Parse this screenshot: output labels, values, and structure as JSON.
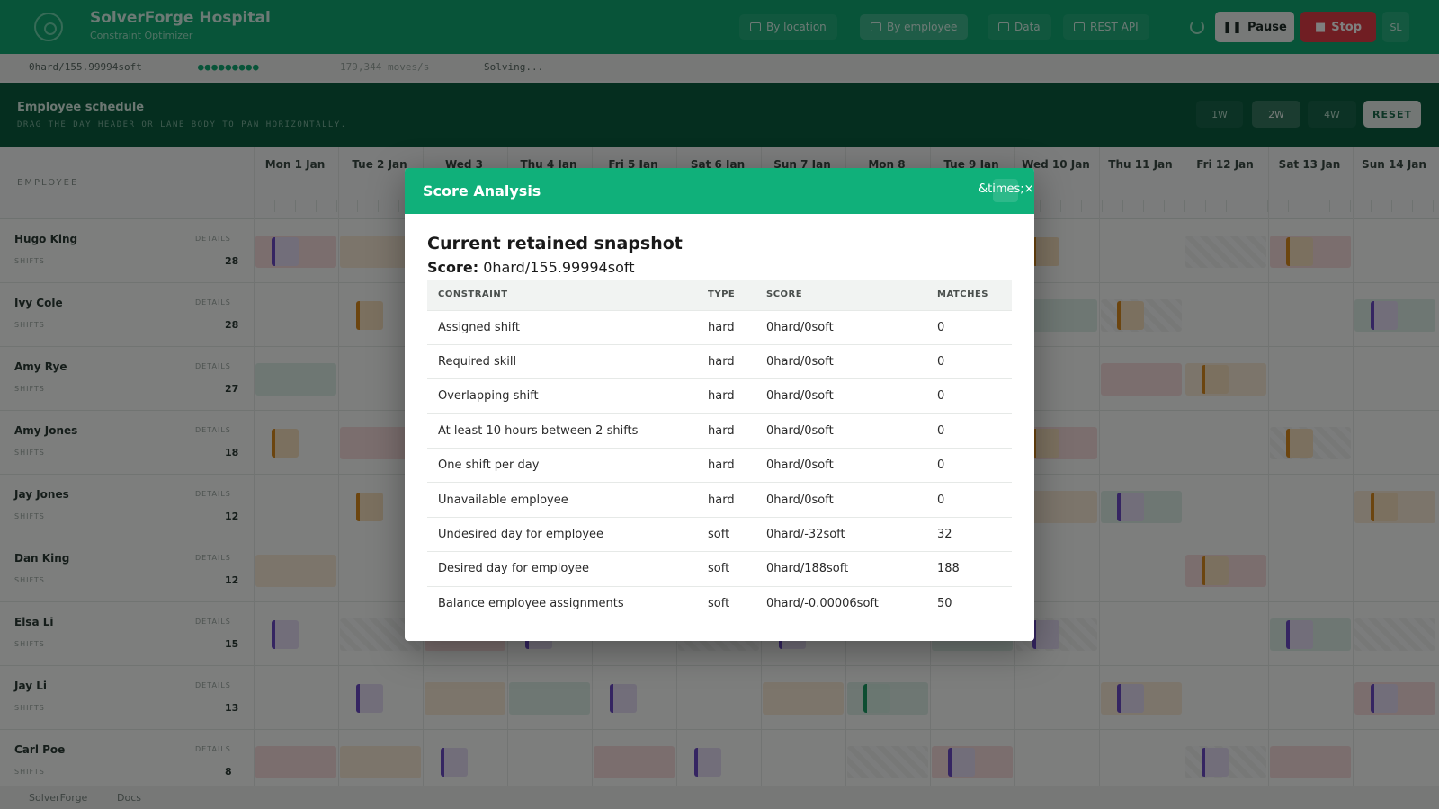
{
  "app": {
    "title": "SolverForge Hospital",
    "subtitle": "Constraint Optimizer",
    "nav": [
      {
        "label": "By location",
        "active": false
      },
      {
        "label": "By employee",
        "active": true
      },
      {
        "label": "Data",
        "active": false
      },
      {
        "label": "REST API",
        "active": false
      }
    ],
    "pause_label": "Pause",
    "stop_label": "Stop",
    "user_initials": "SL"
  },
  "statusbar": {
    "score": "0hard/155.99994soft",
    "dots": "●●●●●●●●●",
    "moves": "179,344 moves/s",
    "state": "Solving..."
  },
  "panel": {
    "title": "Employee schedule",
    "hint": "DRAG THE DAY HEADER OR LANE BODY TO PAN HORIZONTALLY.",
    "zoom": [
      "1W",
      "2W",
      "4W"
    ],
    "zoom_active": "2W",
    "reset_label": "RESET"
  },
  "grid": {
    "employee_header": "EMPLOYEE",
    "days": [
      "Mon 1 Jan",
      "Tue 2 Jan",
      "Wed 3",
      "Thu 4 Jan",
      "Fri 5 Jan",
      "Sat 6 Jan",
      "Sun 7 Jan",
      "Mon 8",
      "Tue 9 Jan",
      "Wed 10 Jan",
      "Thu 11 Jan",
      "Fri 12 Jan",
      "Sat 13 Jan",
      "Sun 14 Jan"
    ],
    "detail_label": "DETAILS",
    "shifts_label": "SHIFTS",
    "employees": [
      {
        "name": "Hugo King",
        "shifts": "28"
      },
      {
        "name": "Ivy Cole",
        "shifts": "28"
      },
      {
        "name": "Amy Rye",
        "shifts": "27"
      },
      {
        "name": "Amy Jones",
        "shifts": "18"
      },
      {
        "name": "Jay Jones",
        "shifts": "12"
      },
      {
        "name": "Dan King",
        "shifts": "12"
      },
      {
        "name": "Elsa Li",
        "shifts": "15"
      },
      {
        "name": "Jay Li",
        "shifts": "13"
      },
      {
        "name": "Carl Poe",
        "shifts": "8"
      }
    ]
  },
  "footer": {
    "left": "SolverForge",
    "right": "Docs"
  },
  "modal": {
    "title": "Score Analysis",
    "close_label": "&times;×",
    "snapshot_title": "Current retained snapshot",
    "score_label": "Score:",
    "score_value": "0hard/155.99994soft",
    "columns": [
      "CONSTRAINT",
      "TYPE",
      "SCORE",
      "MATCHES"
    ],
    "rows": [
      {
        "constraint": "Assigned shift",
        "type": "hard",
        "score": "0hard/0soft",
        "matches": "0"
      },
      {
        "constraint": "Required skill",
        "type": "hard",
        "score": "0hard/0soft",
        "matches": "0"
      },
      {
        "constraint": "Overlapping shift",
        "type": "hard",
        "score": "0hard/0soft",
        "matches": "0"
      },
      {
        "constraint": "At least 10 hours between 2 shifts",
        "type": "hard",
        "score": "0hard/0soft",
        "matches": "0"
      },
      {
        "constraint": "One shift per day",
        "type": "hard",
        "score": "0hard/0soft",
        "matches": "0"
      },
      {
        "constraint": "Unavailable employee",
        "type": "hard",
        "score": "0hard/0soft",
        "matches": "0"
      },
      {
        "constraint": "Undesired day for employee",
        "type": "soft",
        "score": "0hard/-32soft",
        "matches": "32"
      },
      {
        "constraint": "Desired day for employee",
        "type": "soft",
        "score": "0hard/188soft",
        "matches": "188"
      },
      {
        "constraint": "Balance employee assignments",
        "type": "soft",
        "score": "0hard/-0.00006soft",
        "matches": "50"
      }
    ]
  }
}
